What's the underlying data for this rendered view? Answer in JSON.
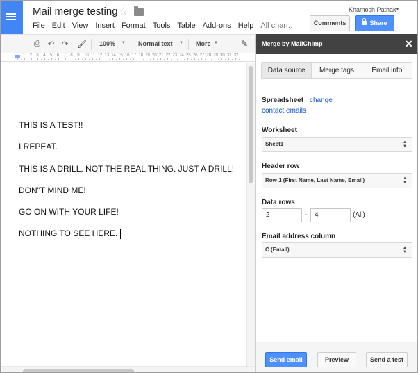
{
  "header": {
    "doc_title": "Mail merge testing",
    "user_name": "Khamosh Pathak",
    "comments_label": "Comments",
    "share_label": "Share",
    "menu": [
      "File",
      "Edit",
      "View",
      "Insert",
      "Format",
      "Tools",
      "Table",
      "Add-ons",
      "Help"
    ],
    "save_status": "All chan…"
  },
  "toolbar": {
    "zoom": "100%",
    "style": "Normal text",
    "more": "More"
  },
  "ruler": {
    "numbers": [
      "1",
      "2",
      "3",
      "4",
      "5",
      "6",
      "7",
      "8",
      "9",
      "10",
      "11",
      "12",
      "13",
      "14",
      "15",
      "16",
      "17",
      "18",
      "19",
      "20",
      "21",
      "22",
      "23",
      "24",
      "25",
      "26",
      "27",
      "28",
      "29",
      "30",
      "31",
      "32",
      "33",
      "34"
    ]
  },
  "document": {
    "lines": [
      "THIS IS A TEST!!",
      "I REPEAT.",
      "THIS IS A DRILL. NOT THE REAL THING. JUST A DRILL!",
      "DON\"T MIND ME!",
      "GO ON WITH YOUR LIFE!",
      "NOTHING TO SEE HERE."
    ]
  },
  "sidebar": {
    "title": "Merge by MailChimp",
    "tabs": [
      "Data source",
      "Merge tags",
      "Email info"
    ],
    "spreadsheet_label": "Spreadsheet",
    "change_link": "change",
    "spreadsheet_name": "contact emails",
    "worksheet_label": "Worksheet",
    "worksheet_value": "Sheet1",
    "header_row_label": "Header row",
    "header_row_value": "Row 1 (First Name, Last Name, Email)",
    "data_rows_label": "Data rows",
    "data_rows_from": "2",
    "data_rows_to": "4",
    "data_rows_all": "(All)",
    "email_column_label": "Email address column",
    "email_column_value": "C (Email)",
    "send_email_label": "Send email",
    "preview_label": "Preview",
    "send_test_label": "Send a test"
  }
}
